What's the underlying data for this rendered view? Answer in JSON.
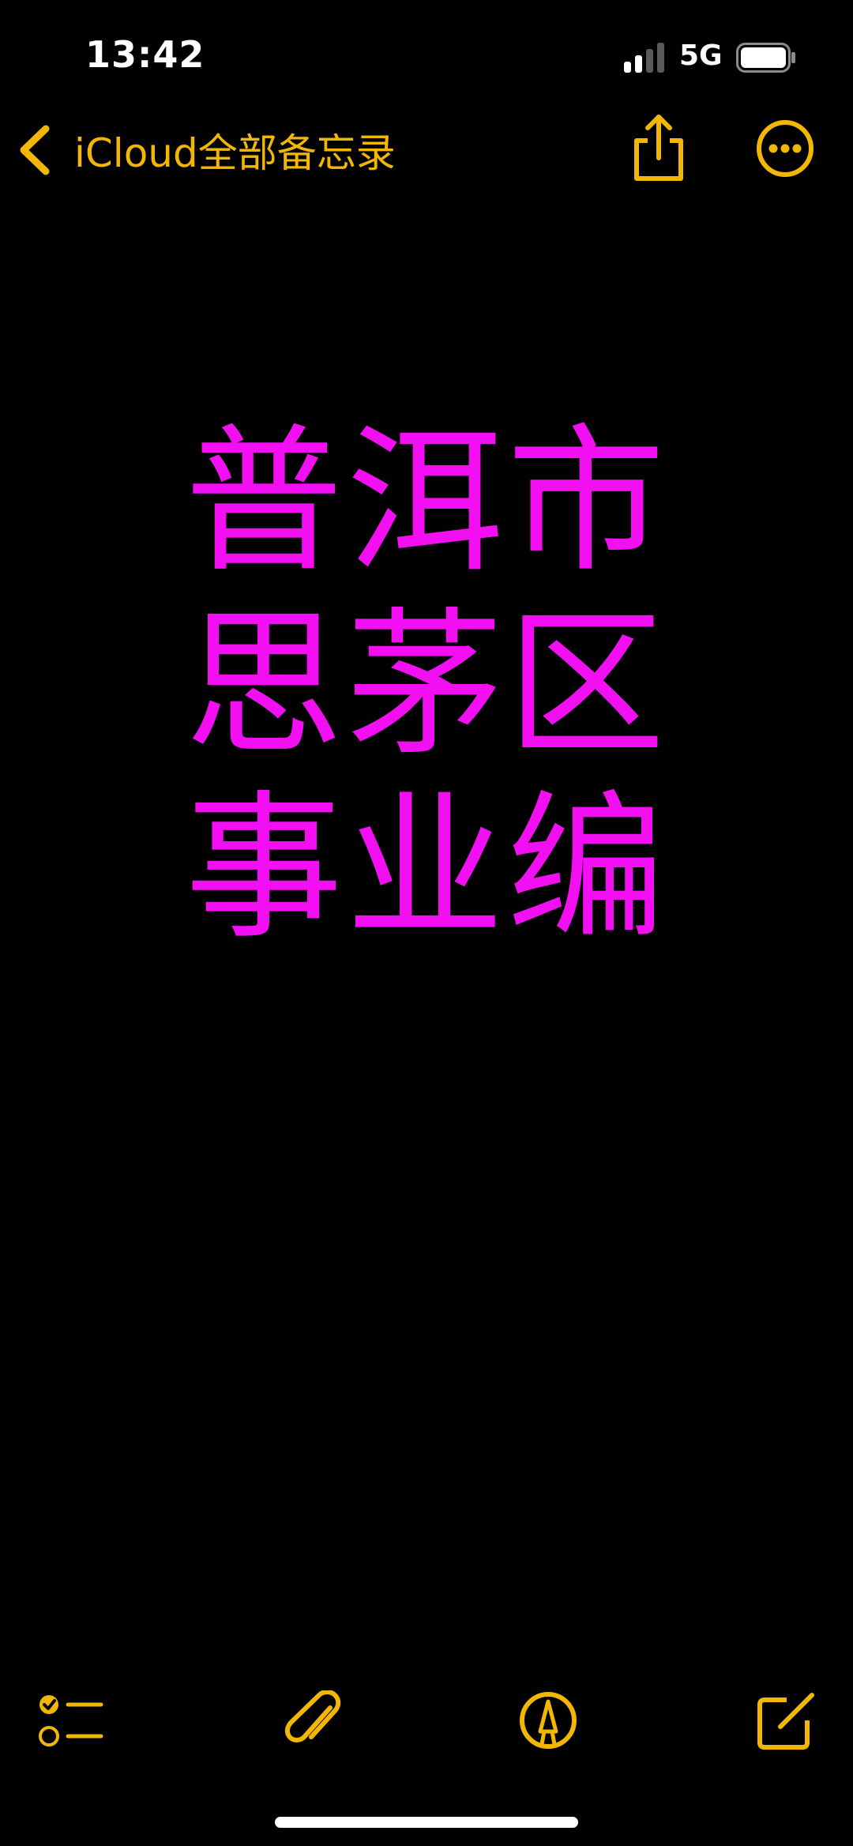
{
  "status_bar": {
    "time": "13:42",
    "network": "5G",
    "battery_icon": "battery-icon",
    "signal_icon": "signal-icon"
  },
  "nav": {
    "back_label": "iCloud全部备忘录",
    "back_icon": "chevron-left-icon",
    "share_icon": "share-icon",
    "more_icon": "more-icon"
  },
  "note": {
    "lines": [
      "普洱市",
      "思茅区",
      "事业编"
    ]
  },
  "toolbar": {
    "checklist_icon": "checklist-icon",
    "attach_icon": "paperclip-icon",
    "markup_icon": "markup-pen-icon",
    "compose_icon": "compose-icon"
  },
  "colors": {
    "accent": "#f2b705",
    "note_text": "#f20ff2",
    "background": "#000000"
  }
}
